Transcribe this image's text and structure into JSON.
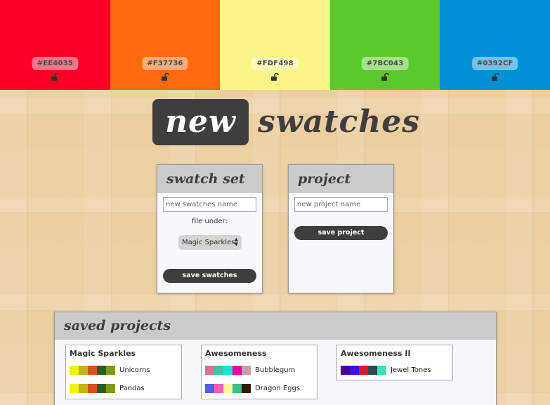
{
  "swatches": [
    {
      "hex": "#EE4035",
      "color": "#fe0025"
    },
    {
      "hex": "#F37736",
      "color": "#fe690b"
    },
    {
      "hex": "#FDF498",
      "color": "#fbf585"
    },
    {
      "hex": "#7BC043",
      "color": "#5bc92e"
    },
    {
      "hex": "#0392CF",
      "color": "#038fd6"
    }
  ],
  "title": {
    "highlight": "new",
    "rest": "swatches"
  },
  "swatch_set": {
    "heading": "swatch set",
    "name_placeholder": "new swatches name",
    "file_under_label": "file under:",
    "file_under_value": "Magic Sparkles",
    "save_label": "save swatches"
  },
  "project": {
    "heading": "project",
    "name_placeholder": "new project name",
    "save_label": "save project"
  },
  "saved_projects": {
    "heading": "saved projects",
    "projects": [
      {
        "name": "Magic Sparkles",
        "sets": [
          {
            "name": "Unicorns",
            "colors": [
              "#f5f200",
              "#c2b414",
              "#d4531e",
              "#2f5a23",
              "#7e9a14"
            ]
          },
          {
            "name": "Pandas",
            "colors": [
              "#f5f200",
              "#c2b414",
              "#d4531e",
              "#2f5a23",
              "#7e9a14"
            ]
          }
        ]
      },
      {
        "name": "Awesomeness",
        "sets": [
          {
            "name": "Bubblegum",
            "colors": [
              "#e76e8c",
              "#38c5a6",
              "#1fe3c9",
              "#ee00a8",
              "#c6a1a9"
            ]
          },
          {
            "name": "Dragon Eggs",
            "colors": [
              "#4b5ffe",
              "#ff5fb5",
              "#fef59b",
              "#3fbf8a",
              "#3a1607"
            ]
          }
        ]
      },
      {
        "name": "Awesomeness II",
        "sets": [
          {
            "name": "Jewel Tones",
            "colors": [
              "#4a0597",
              "#3a0fef",
              "#da1928",
              "#2f4a4a",
              "#38e5b6"
            ]
          }
        ]
      }
    ]
  }
}
